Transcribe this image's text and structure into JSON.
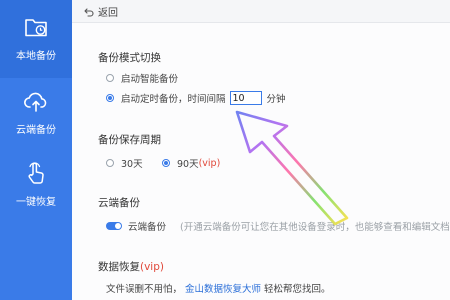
{
  "sidebar": {
    "items": [
      {
        "label": "本地备份",
        "icon": "folder-clock-icon"
      },
      {
        "label": "云端备份",
        "icon": "cloud-upload-icon"
      },
      {
        "label": "一键恢复",
        "icon": "hand-pointer-icon"
      }
    ]
  },
  "topbar": {
    "back_label": "返回"
  },
  "backup_mode": {
    "title": "备份模式切换",
    "smart_label": "启动智能备份",
    "scheduled_label": "启动定时备份，时间间隔",
    "interval_value": "10",
    "interval_unit": "分钟",
    "selected": "scheduled"
  },
  "retention": {
    "title": "备份保存周期",
    "option_30": "30天",
    "option_90": "90天",
    "option_90_badge": "(vip)",
    "selected": "90"
  },
  "cloud": {
    "title": "云端备份",
    "toggle_label": "云端备份",
    "toggle_on": true,
    "hint": "(开通云端备份可让您在其他设备登录时，也能够查看和编辑文档。"
  },
  "recovery": {
    "title": "数据恢复",
    "title_badge": "(vip)",
    "text_before": "文件误删不用怕，",
    "link": "金山数据恢复大师",
    "text_after": "轻松帮您找回。"
  },
  "colors": {
    "accent": "#3a7be8",
    "vip": "#e0483a",
    "link": "#2b6fd8"
  }
}
